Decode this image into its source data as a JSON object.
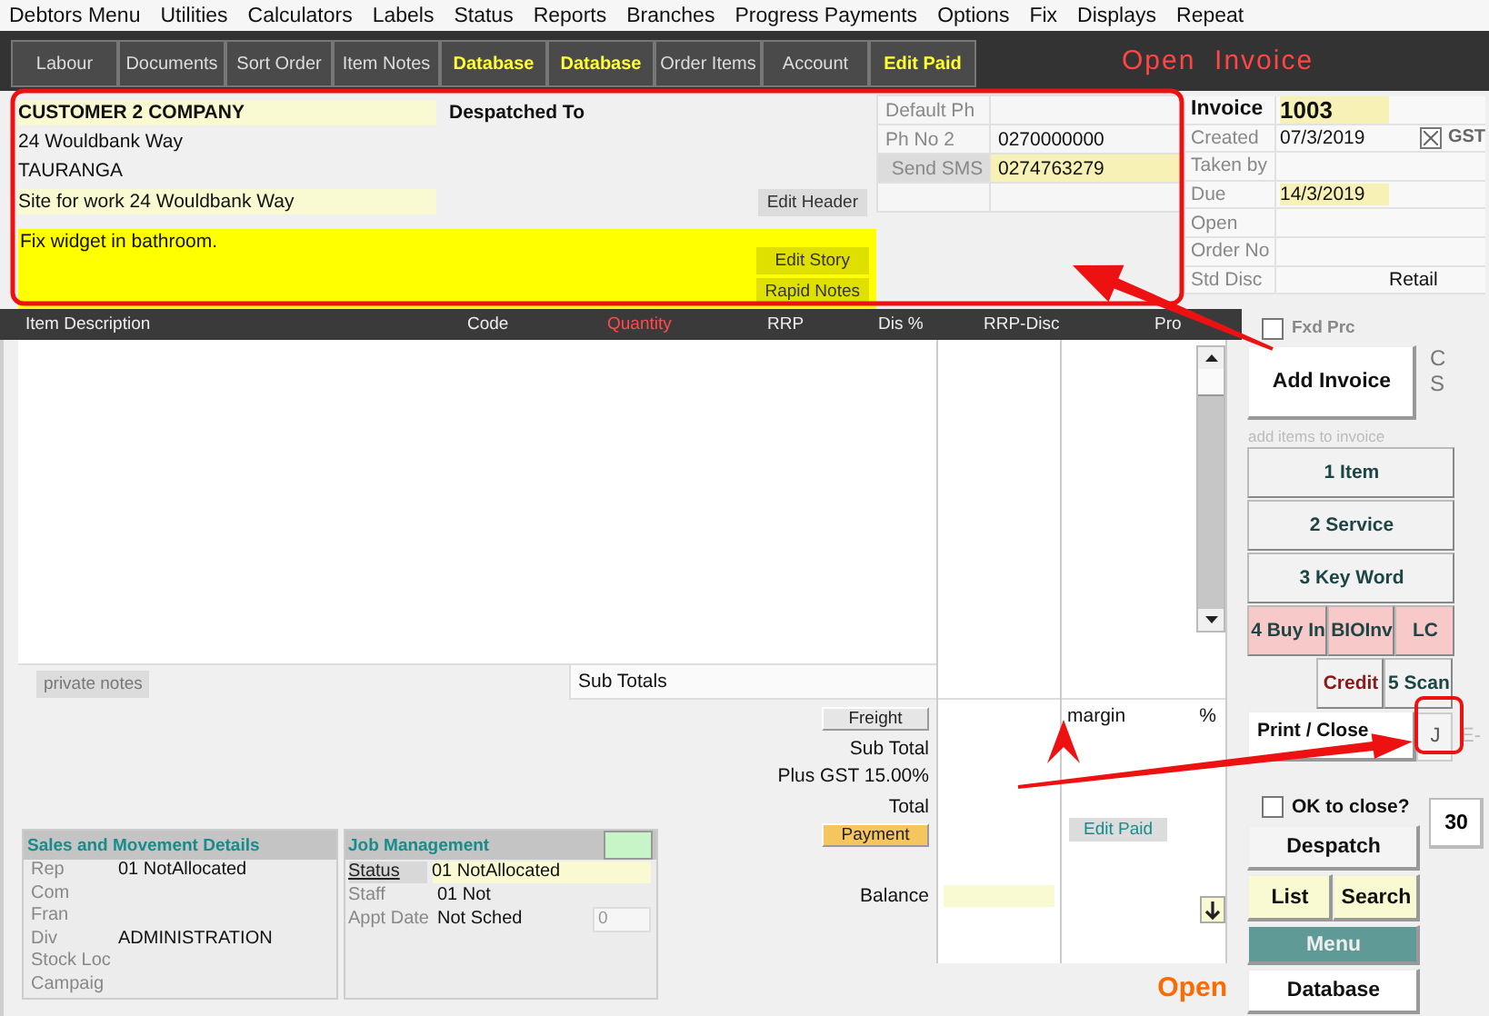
{
  "menu": [
    "Debtors Menu",
    "Utilities",
    "Calculators",
    "Labels",
    "Status",
    "Reports",
    "Branches",
    "Progress Payments",
    "Options",
    "Fix",
    "Displays",
    "Repeat"
  ],
  "tabs": [
    {
      "label": "Labour",
      "highlighted": false
    },
    {
      "label": "Documents",
      "highlighted": false
    },
    {
      "label": "Sort Order",
      "highlighted": false
    },
    {
      "label": "Item Notes",
      "highlighted": false
    },
    {
      "label": "Database",
      "highlighted": true
    },
    {
      "label": "Database",
      "highlighted": true
    },
    {
      "label": "Order Items",
      "highlighted": false
    },
    {
      "label": "Account",
      "highlighted": false
    },
    {
      "label": "Edit Paid",
      "highlighted": true
    }
  ],
  "title": "Open  Invoice",
  "customer": {
    "name": "CUSTOMER 2 COMPANY",
    "despatch_heading": "Despatched To",
    "address_lines": [
      "24 Wouldbank Way",
      "TAURANGA"
    ],
    "site": "Site for work 24 Wouldbank Way",
    "edit_header": "Edit Header",
    "story": "Fix widget in bathroom.",
    "story_buttons": [
      "Edit Story",
      "Rapid Notes"
    ]
  },
  "phones": [
    {
      "label": "Default Ph",
      "kind": "label"
    },
    {
      "label": "Ph No 2",
      "value": "0270000000",
      "kind": "label",
      "highlighted": false
    },
    {
      "label": "Send SMS",
      "value": "0274763279",
      "kind": "button",
      "highlighted": true
    }
  ],
  "invoice": {
    "rows": [
      {
        "label": "Invoice",
        "value": "1003",
        "kind": "title",
        "highlighted": true
      },
      {
        "label": "Created",
        "value": "07/3/2019",
        "kind": "plain",
        "highlighted": false
      },
      {
        "label": "Taken by",
        "kind": "plain"
      },
      {
        "label": "Due",
        "value": "14/3/2019",
        "kind": "plain",
        "highlighted": true
      },
      {
        "label": "Open",
        "kind": "plain"
      },
      {
        "label": "Order No",
        "kind": "plain"
      },
      {
        "label": "Std Disc",
        "value": "Retail",
        "kind": "plain"
      }
    ],
    "gst": {
      "label": "GST",
      "checked": true
    }
  },
  "grid": {
    "columns": [
      {
        "label": "Item Description",
        "highlighted": false
      },
      {
        "label": "Code",
        "highlighted": false
      },
      {
        "label": "Quantity",
        "highlighted": true
      },
      {
        "label": "RRP",
        "highlighted": false
      },
      {
        "label": "Dis %",
        "highlighted": false
      },
      {
        "label": "RRP-Disc",
        "highlighted": false
      },
      {
        "label": "Pro",
        "highlighted": false
      }
    ]
  },
  "private_notes": "private notes",
  "sub_totals": "Sub Totals",
  "totals": {
    "freight": "Freight",
    "sub_total": "Sub Total",
    "gst": "Plus GST 15.00%",
    "total": "Total",
    "payment": "Payment",
    "balance": "Balance",
    "margin": "margin",
    "percent": "%",
    "edit_paid": "Edit Paid"
  },
  "status_text": "Open",
  "sales": {
    "title": "Sales and Movement Details",
    "rows": [
      {
        "label": "Rep",
        "value": "01 NotAllocated"
      },
      {
        "label": "Com"
      },
      {
        "label": "Fran"
      },
      {
        "label": "Div",
        "value": "ADMINISTRATION"
      },
      {
        "label": "Stock Loc"
      },
      {
        "label": "Campaig"
      }
    ]
  },
  "job": {
    "title": "Job Management",
    "rows": [
      {
        "label": "Status",
        "value": "01 NotAllocated",
        "kind": "button"
      },
      {
        "label": "Staff",
        "value": "01 Not",
        "kind": "label"
      },
      {
        "label": "Appt Date",
        "value": "Not Sched",
        "kind": "label"
      }
    ],
    "appt_count": "0"
  },
  "side": {
    "fixed_price": {
      "label": "Fxd Prc",
      "checked": false
    },
    "add_invoice": "Add Invoice",
    "side_letters": [
      "C",
      "S"
    ],
    "hint": "add items to invoice",
    "item_rows": [
      {
        "buttons": [
          {
            "label": "1 Item",
            "kind": "plain"
          }
        ]
      },
      {
        "buttons": [
          {
            "label": "2 Service",
            "kind": "plain"
          }
        ]
      },
      {
        "buttons": [
          {
            "label": "3 Key Word",
            "kind": "plain"
          }
        ]
      },
      {
        "buttons": [
          {
            "label": "4 Buy In",
            "kind": "pink"
          },
          {
            "label": "BIOInv",
            "kind": "pink"
          },
          {
            "label": "LC",
            "kind": "pink"
          }
        ]
      },
      {
        "buttons": [
          {
            "label": "Credit",
            "kind": "credit"
          },
          {
            "label": "5 Scan",
            "kind": "plain"
          }
        ]
      }
    ],
    "print_close": "Print / Close",
    "j_button": "J",
    "e_label": "E-",
    "ok_to_close": {
      "label": "OK to close?",
      "checked": false
    },
    "count": "30",
    "despatch": "Despatch",
    "list": "List",
    "search": "Search",
    "menu": "Menu",
    "database": "Database"
  }
}
